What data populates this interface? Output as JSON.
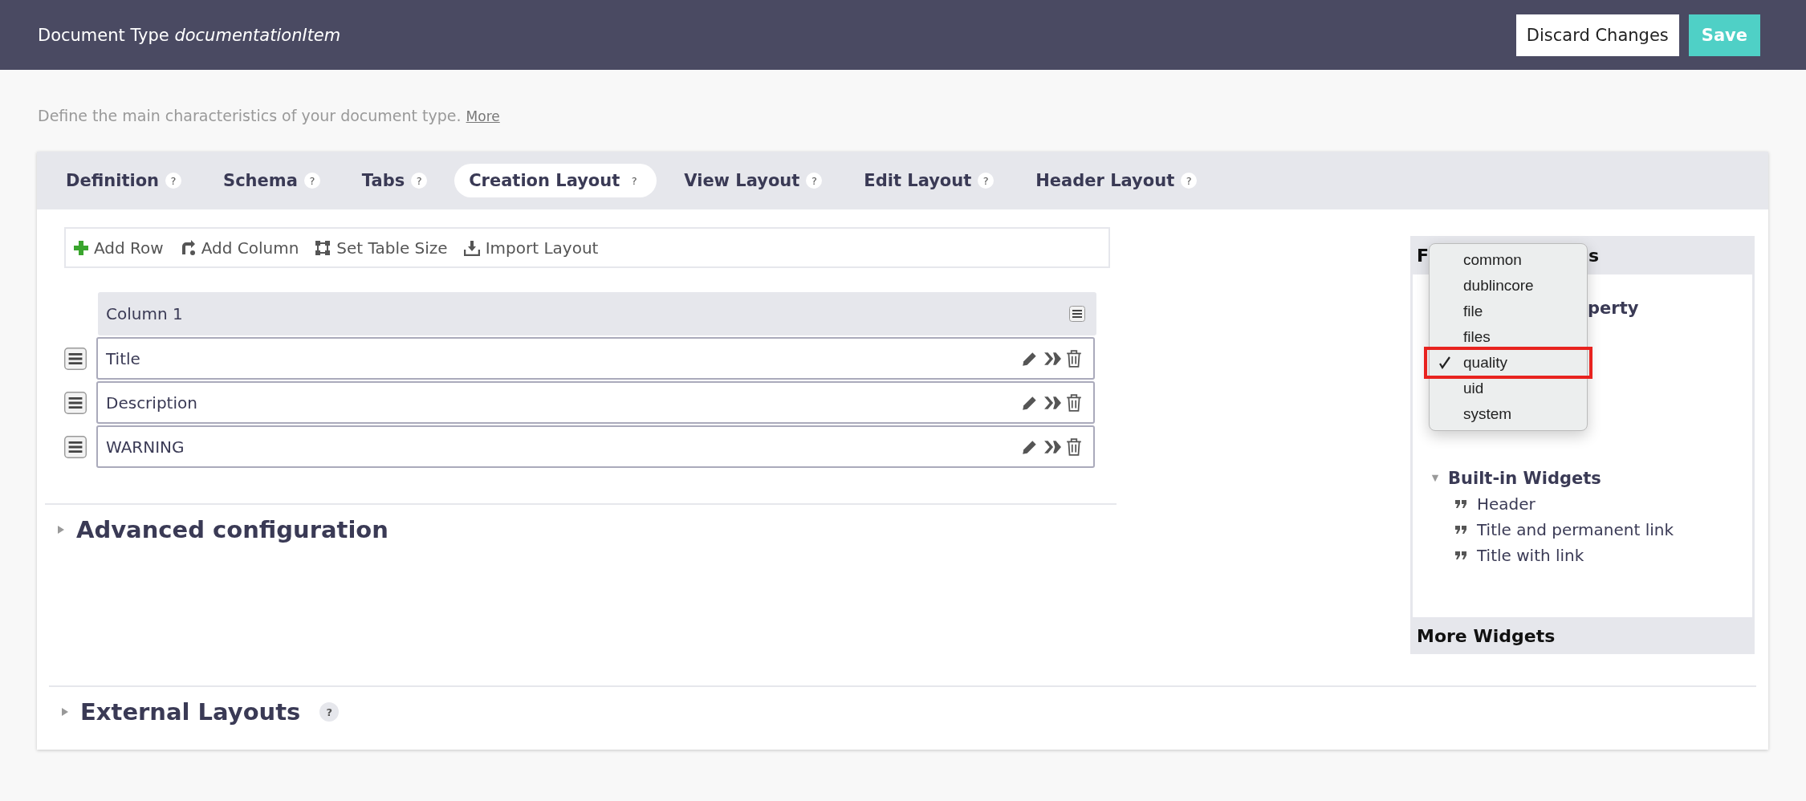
{
  "header": {
    "title": "Document Type",
    "title_name": "documentationItem",
    "buttons": [
      {
        "label": "Discard Changes",
        "kind": "secondary"
      },
      {
        "label": "Save",
        "kind": "primary"
      }
    ]
  },
  "intro": {
    "text": "Define the main characteristics of your document type.",
    "link": "More"
  },
  "tabs": [
    {
      "label": "Definition",
      "help": "?",
      "selected": false
    },
    {
      "label": "Schema",
      "help": "?",
      "selected": false
    },
    {
      "label": "Tabs",
      "help": "?",
      "selected": false
    },
    {
      "label": "Creation Layout",
      "help": "?",
      "selected": true
    },
    {
      "label": "View Layout",
      "help": "?",
      "selected": false
    },
    {
      "label": "Edit Layout",
      "help": "?",
      "selected": false
    },
    {
      "label": "Header Layout",
      "help": "?",
      "selected": false
    }
  ],
  "toolbar": [
    {
      "label": "Add Row",
      "kind": "add"
    },
    {
      "label": "Add Column",
      "kind": "column"
    },
    {
      "label": "Set Table Size",
      "kind": "size"
    },
    {
      "label": "Import Layout",
      "kind": "import"
    }
  ],
  "layout_table": {
    "column": "Column 1",
    "rows": [
      {
        "label": "Title"
      },
      {
        "label": "Description"
      },
      {
        "label": "WARNING"
      }
    ]
  },
  "sections": [
    {
      "title": "Advanced configuration",
      "expanded": false
    },
    {
      "title": "External Layouts",
      "help": "?",
      "expanded": false
    }
  ],
  "side_panel": {
    "header_start": "F",
    "header_end": "s",
    "partial_line": "perty",
    "groups": [
      {
        "title": "Built-in Widgets",
        "expanded": true,
        "items": [
          {
            "label": "Header"
          },
          {
            "label": "Title and permanent link"
          },
          {
            "label": "Title with link"
          }
        ]
      }
    ],
    "footer": "More Widgets"
  },
  "dropdown": {
    "options": [
      {
        "label": "common",
        "selected": false
      },
      {
        "label": "dublincore",
        "selected": false
      },
      {
        "label": "file",
        "selected": false
      },
      {
        "label": "files",
        "selected": false
      },
      {
        "label": "quality",
        "selected": true
      },
      {
        "label": "uid",
        "selected": false
      },
      {
        "label": "system",
        "selected": false
      }
    ]
  }
}
